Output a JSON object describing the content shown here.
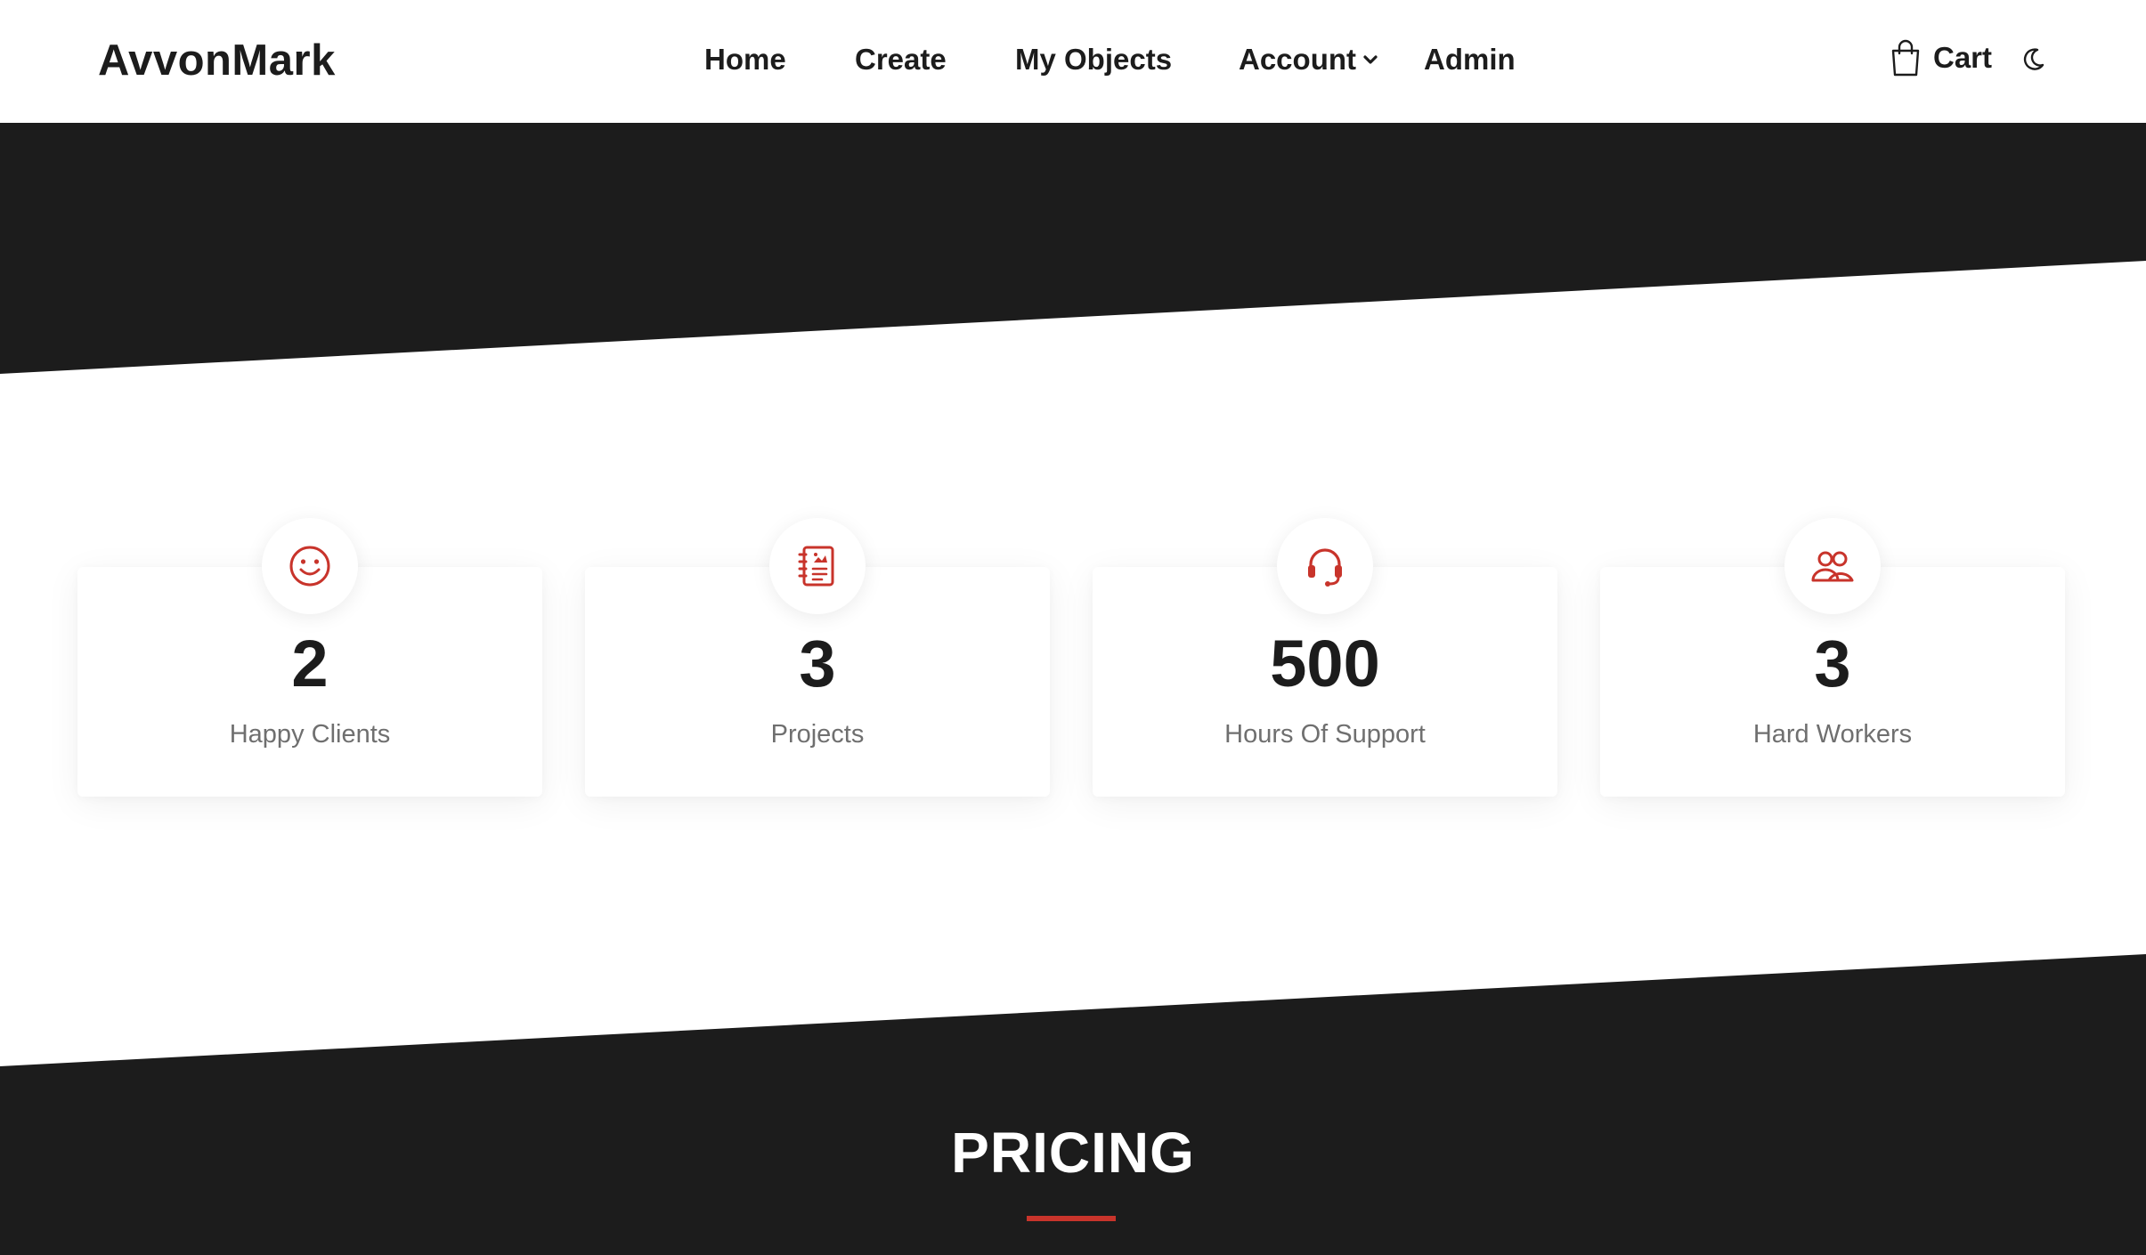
{
  "header": {
    "brand": "AvvonMark",
    "nav": [
      {
        "label": "Home"
      },
      {
        "label": "Create"
      },
      {
        "label": "My Objects"
      },
      {
        "label": "Account",
        "has_dropdown": true
      },
      {
        "label": "Admin"
      }
    ],
    "cart_label": "Cart",
    "icons": {
      "cart": "shopping-bag-icon",
      "theme": "moon-icon",
      "dropdown": "chevron-down-icon"
    }
  },
  "stats": [
    {
      "value": "2",
      "label": "Happy Clients",
      "icon": "smile-icon"
    },
    {
      "value": "3",
      "label": "Projects",
      "icon": "project-notebook-icon"
    },
    {
      "value": "500",
      "label": "Hours Of Support",
      "icon": "headset-icon"
    },
    {
      "value": "3",
      "label": "Hard Workers",
      "icon": "users-icon"
    }
  ],
  "pricing": {
    "title": "PRICING"
  },
  "colors": {
    "dark_band": "#1c1c1c",
    "accent": "#c8342b",
    "text": "#1c1c1c",
    "muted": "#6f6f6f",
    "background": "#ffffff"
  }
}
